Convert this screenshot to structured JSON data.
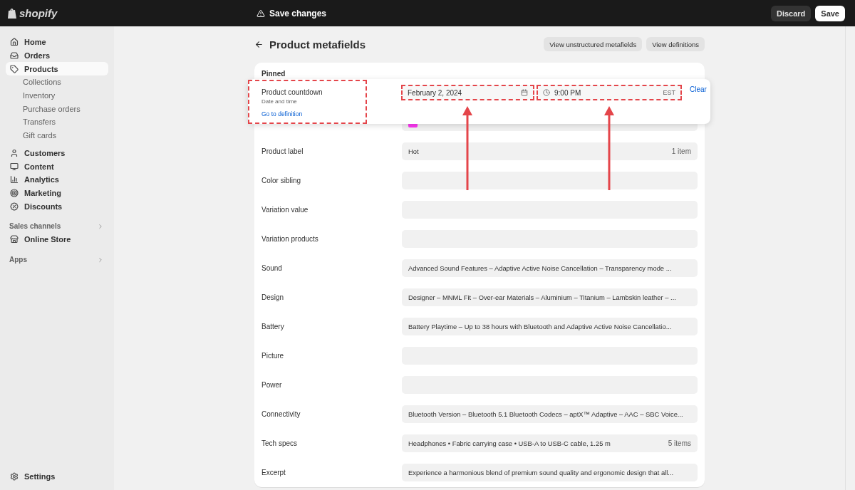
{
  "topbar": {
    "logo": "shopify",
    "message": "Save changes",
    "buttons": [
      {
        "label": "Discard",
        "kind": "secondary"
      },
      {
        "label": "Save",
        "kind": "primary"
      }
    ]
  },
  "sidebar": {
    "items": [
      {
        "label": "Home",
        "selected": false
      },
      {
        "label": "Orders",
        "selected": false
      },
      {
        "label": "Products",
        "selected": true,
        "children": [
          {
            "label": "Collections",
            "selected": false
          },
          {
            "label": "Inventory",
            "selected": false
          },
          {
            "label": "Purchase orders",
            "selected": false
          },
          {
            "label": "Transfers",
            "selected": false
          },
          {
            "label": "Gift cards",
            "selected": false
          }
        ]
      },
      {
        "label": "Customers",
        "selected": false
      },
      {
        "label": "Content",
        "selected": false
      },
      {
        "label": "Analytics",
        "selected": false
      },
      {
        "label": "Marketing",
        "selected": false
      },
      {
        "label": "Discounts",
        "selected": false
      }
    ],
    "sections": [
      {
        "title": "Sales channels",
        "items": [
          {
            "label": "Online Store",
            "selected": false
          }
        ]
      },
      {
        "title": "Apps"
      }
    ],
    "footer": {
      "label": "Settings",
      "selected": false
    }
  },
  "page": {
    "title": "Product metafields",
    "actions": [
      "View unstructured metafields",
      "View definitions"
    ]
  },
  "card": {
    "heading": "Pinned",
    "pinned": {
      "name": "Product countdown",
      "type": "Date and time",
      "link": "Go to definition",
      "date": "February 2, 2024",
      "time": "9:00 PM",
      "timezone": "EST",
      "clear": "Clear"
    },
    "rows": [
      {
        "kind": "swatch",
        "color": "#fb37f1"
      },
      {
        "kind": "text",
        "label": "Product label",
        "value": "Hot",
        "count": "1 item"
      },
      {
        "kind": "text",
        "label": "Color sibling"
      },
      {
        "kind": "text",
        "label": "Variation value"
      },
      {
        "kind": "text",
        "label": "Variation products"
      },
      {
        "kind": "text",
        "label": "Sound",
        "value": "Advanced Sound Features – Adaptive Active Noise Cancellation – Transparency mode ..."
      },
      {
        "kind": "text",
        "label": "Design",
        "value": "Designer – MNML Fit – Over-ear Materials – Aluminium – Titanium – Lambskin leather – ..."
      },
      {
        "kind": "text",
        "label": "Battery",
        "value": "Battery Playtime – Up to 38 hours with Bluetooth and Adaptive Active Noise Cancellatio..."
      },
      {
        "kind": "text",
        "label": "Picture"
      },
      {
        "kind": "text",
        "label": "Power"
      },
      {
        "kind": "text",
        "label": "Connectivity",
        "value": "Bluetooth Version – Bluetooth 5.1 Bluetooth Codecs – aptX™ Adaptive – AAC – SBC Voice..."
      },
      {
        "kind": "text",
        "label": "Tech specs",
        "value": "Headphones • Fabric carrying case • USB-A to USB-C cable, 1.25 m",
        "count": "5 items"
      },
      {
        "kind": "text",
        "label": "Excerpt",
        "value": "Experience a harmonious blend of premium sound quality and ergonomic design that all..."
      }
    ]
  }
}
